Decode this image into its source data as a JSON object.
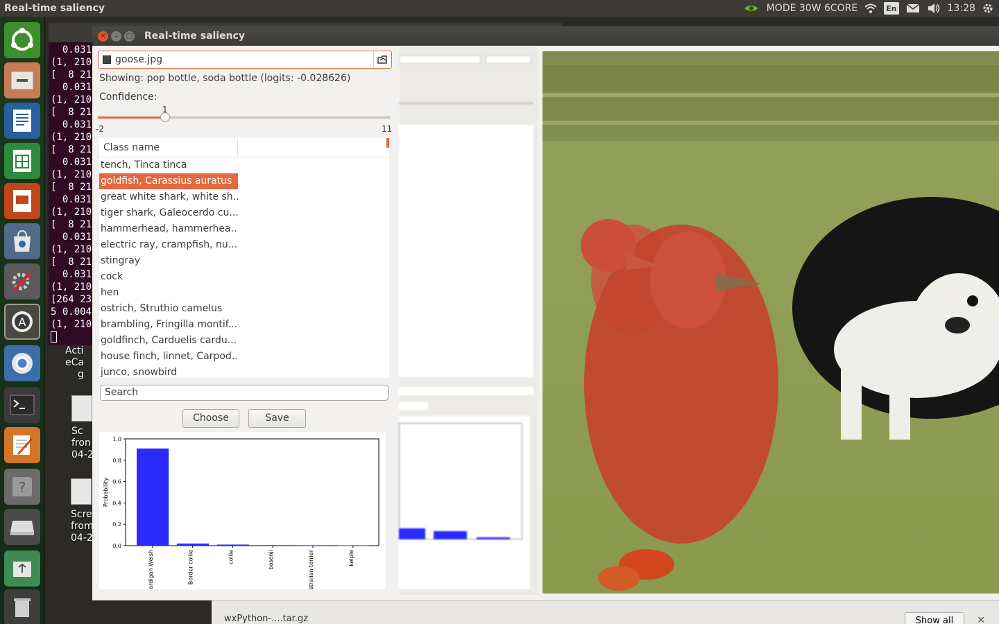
{
  "top_panel": {
    "title": "Real-time saliency",
    "mode": "MODE 30W 6CORE",
    "lang": "En",
    "time": "13:28"
  },
  "terminal": {
    "lines": [
      "  0.031",
      "(1, 210",
      "[  8 21",
      "  0.031",
      "(1, 210",
      "[  8 21",
      "  0.031",
      "(1, 210",
      "[  8 21",
      "  0.031",
      "(1, 210",
      "[  8 21",
      "  0.031",
      "(1, 210",
      "[  8 21",
      "  0.031",
      "(1, 210",
      "[  8 21",
      "  0.031",
      "(1, 210",
      "[264 23",
      "5 0.004",
      "(1, 210"
    ]
  },
  "desktop": {
    "icon1_line1": "Acti",
    "icon1_line2": "eCa",
    "icon1_line3": "g",
    "icon2_line1": "Sc",
    "icon2_line2": "fron",
    "icon2_line3": "04-2",
    "icon3_line1": "Scre",
    "icon3_line2": "from",
    "icon3_line3": "04-2"
  },
  "bottom_bar": {
    "download": "wxPython-....tar.gz",
    "show_all": "Show all"
  },
  "window": {
    "title": "Real-time saliency",
    "file_name": "goose.jpg",
    "showing": "Showing: pop bottle, soda bottle (logits: -0.028626)",
    "confidence_label": "Confidence:",
    "slider": {
      "min": "-2",
      "max": "11",
      "value": "1",
      "value_fraction": 0.23
    },
    "class_header": "Class name",
    "classes": [
      "tench, Tinca tinca",
      "goldfish, Carassius auratus",
      "great white shark, white sh...",
      "tiger shark, Galeocerdo cu...",
      "hammerhead, hammerhea...",
      "electric ray, crampfish, nu...",
      "stingray",
      "cock",
      "hen",
      "ostrich, Struthio camelus",
      "brambling, Fringilla montif...",
      "goldfinch, Carduelis cardu...",
      "house finch, linnet, Carpod...",
      "junco, snowbird"
    ],
    "selected_index": 1,
    "search_placeholder": "Search",
    "choose_label": "Choose",
    "save_label": "Save"
  },
  "chart_data": {
    "type": "bar",
    "categories": [
      "Cardigan, Cardigan Welsh",
      "Border collie",
      "collie",
      "basenji",
      "Australian terrier",
      "kelpie"
    ],
    "values": [
      0.91,
      0.02,
      0.01,
      0.005,
      0.004,
      0.003
    ],
    "ylabel": "Probability",
    "ylim": [
      0,
      1.0
    ],
    "yticks": [
      "0.0",
      "0.2",
      "0.4",
      "0.6",
      "0.8",
      "1.0"
    ],
    "color": "#2b2bff"
  },
  "colors": {
    "accent": "#e5683c",
    "bar": "#2b2bff"
  }
}
